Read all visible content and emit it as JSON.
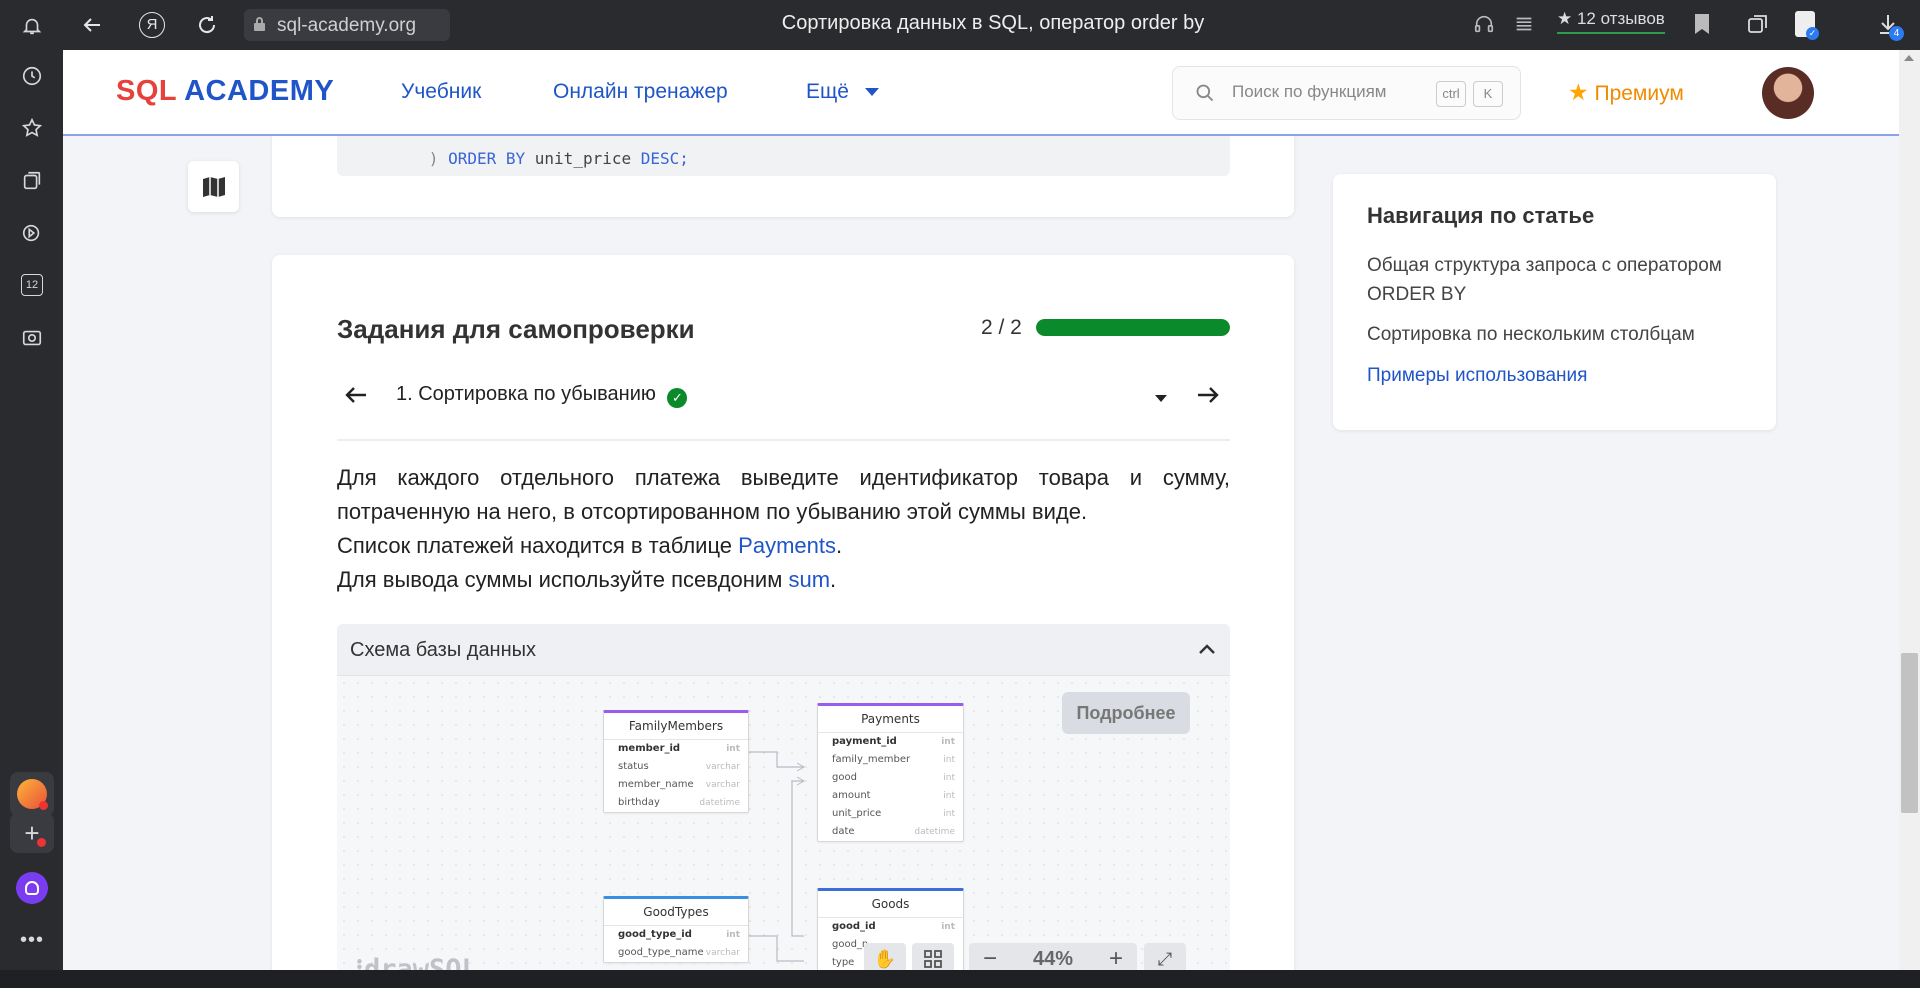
{
  "browser": {
    "url": "sql-academy.org",
    "tab_title": "Сортировка данных в SQL, оператор order by",
    "reviews": "12 отзывов",
    "download_badge": "4",
    "sidebar_badge": "12"
  },
  "site": {
    "logo_sql": "SQL",
    "logo_academy": "ACADEMY",
    "nav": [
      "Учебник",
      "Онлайн тренажер",
      "Ещё"
    ],
    "search_placeholder": "Поиск по функциям",
    "kbd": [
      "ctrl",
      "K"
    ],
    "premium": "Премиум"
  },
  "code_tail": {
    "paren": ")",
    "kw": "ORDER BY",
    "ident": "unit_price",
    "dir": "DESC;"
  },
  "tasks": {
    "title": "Задания для самопроверки",
    "progress_text": "2 / 2",
    "progress_fraction": 1.0,
    "progress_color": "#0a8a2a",
    "current_task": "1. Сортировка по убыванию",
    "p1": "Для каждого отдельного платежа выведите идентификатор товара и сумму, потраченную на него, в отсортированном по убыванию этой суммы виде.",
    "p2_before": "Список платежей находится в таблице ",
    "p2_link": "Payments",
    "p2_after": ".",
    "p3_before": "Для вывода суммы используйте псевдоним ",
    "p3_link": "sum",
    "p3_after": "."
  },
  "schema": {
    "title": "Схема базы данных",
    "more_button": "Подробнее",
    "watermark": "drawSQL",
    "zoom": "44%",
    "tables": {
      "family_members": {
        "name": "FamilyMembers",
        "rows": [
          [
            "member_id",
            "int"
          ],
          [
            "status",
            "varchar"
          ],
          [
            "member_name",
            "varchar"
          ],
          [
            "birthday",
            "datetime"
          ]
        ]
      },
      "payments": {
        "name": "Payments",
        "rows": [
          [
            "payment_id",
            "int"
          ],
          [
            "family_member",
            "int"
          ],
          [
            "good",
            "int"
          ],
          [
            "amount",
            "int"
          ],
          [
            "unit_price",
            "int"
          ],
          [
            "date",
            "datetime"
          ]
        ]
      },
      "good_types": {
        "name": "GoodTypes",
        "rows": [
          [
            "good_type_id",
            "int"
          ],
          [
            "good_type_name",
            "varchar"
          ]
        ]
      },
      "goods": {
        "name": "Goods",
        "rows": [
          [
            "good_id",
            "int"
          ],
          [
            "good_n",
            ""
          ],
          [
            "type",
            ""
          ]
        ]
      }
    }
  },
  "article_nav": {
    "title": "Навигация по статье",
    "items": [
      "Общая структура запроса с оператором ORDER BY",
      "Сортировка по нескольким столбцам",
      "Примеры использования"
    ]
  }
}
